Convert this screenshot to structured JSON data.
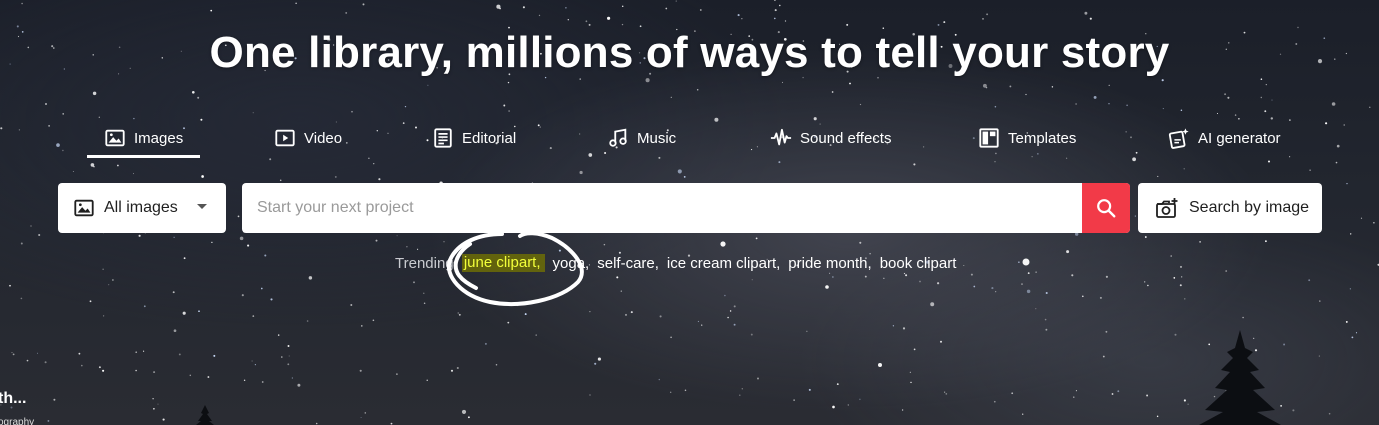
{
  "headline": "One library, millions of ways to tell your story",
  "tabs": [
    {
      "label": "Images",
      "icon": "image-icon",
      "active": true
    },
    {
      "label": "Video",
      "icon": "video-icon",
      "active": false
    },
    {
      "label": "Editorial",
      "icon": "editorial-icon",
      "active": false
    },
    {
      "label": "Music",
      "icon": "music-note-icon",
      "active": false
    },
    {
      "label": "Sound effects",
      "icon": "waveform-icon",
      "active": false
    },
    {
      "label": "Templates",
      "icon": "templates-icon",
      "active": false
    },
    {
      "label": "AI generator",
      "icon": "ai-generator-icon",
      "active": false
    }
  ],
  "search": {
    "type_selected": "All images",
    "placeholder": "Start your next project",
    "value": "",
    "button_icon": "search-icon",
    "image_search_label": "Search by image"
  },
  "trending": {
    "label": "Trending:",
    "terms": [
      "june clipart,",
      "yoga,",
      "self-care,",
      "ice cream clipart,",
      "pride month,",
      "book clipart"
    ]
  },
  "partial": {
    "title": "th...",
    "subtitle": "ography"
  },
  "colors": {
    "accent": "#f23a48",
    "highlight_text": "#f2ff3a"
  }
}
